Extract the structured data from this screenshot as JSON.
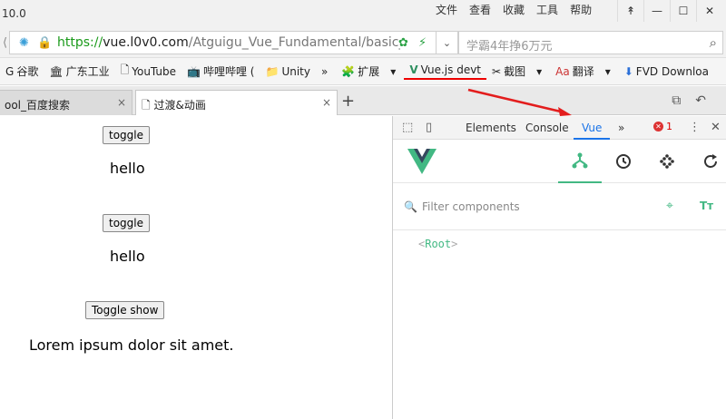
{
  "titlebar": {
    "version": "10.0",
    "menus": [
      "文件",
      "查看",
      "收藏",
      "工具",
      "帮助"
    ],
    "controls": {
      "pin": "↟",
      "minimize": "—",
      "restore": "☐",
      "close": "✕"
    }
  },
  "address": {
    "scheme": "https://",
    "host": "vue.l0v0.com",
    "path": "/Atguigu_Vue_Fundamental/basic_",
    "search_placeholder": "学霸4年挣6万元"
  },
  "bookmarks": [
    {
      "icon": "G",
      "label": "谷歌"
    },
    {
      "icon": "🏛",
      "label": "广东工业"
    },
    {
      "icon": "🗋",
      "label": "YouTube"
    },
    {
      "icon": "📺",
      "label": "哔哩哔哩 ("
    },
    {
      "icon": "📁",
      "label": "Unity"
    },
    {
      "icon": "»",
      "label": ""
    },
    {
      "icon": "🧩",
      "label": "扩展"
    },
    {
      "icon": "▾",
      "label": ""
    },
    {
      "icon": "V",
      "label": "Vue.js devt"
    },
    {
      "icon": "✂",
      "label": "截图"
    },
    {
      "icon": "▾",
      "label": ""
    },
    {
      "icon": "Aa",
      "label": "翻译"
    },
    {
      "icon": "▾",
      "label": ""
    },
    {
      "icon": "⬇",
      "label": "FVD Downloa"
    }
  ],
  "tabs": [
    {
      "label": "ool_百度搜索",
      "close": "×"
    },
    {
      "label": "过渡&动画",
      "close": "×"
    }
  ],
  "newtab": "+",
  "page": {
    "toggle1": "toggle",
    "hello1": "hello",
    "toggle2": "toggle",
    "hello2": "hello",
    "toggle_show": "Toggle show",
    "lorem": "Lorem ipsum dolor sit amet."
  },
  "devtools": {
    "tabs": [
      "Elements",
      "Console",
      "Vue"
    ],
    "more": "»",
    "error_count": "1",
    "filter_placeholder": "Filter components",
    "root": "Root",
    "accent": "#42b883"
  }
}
